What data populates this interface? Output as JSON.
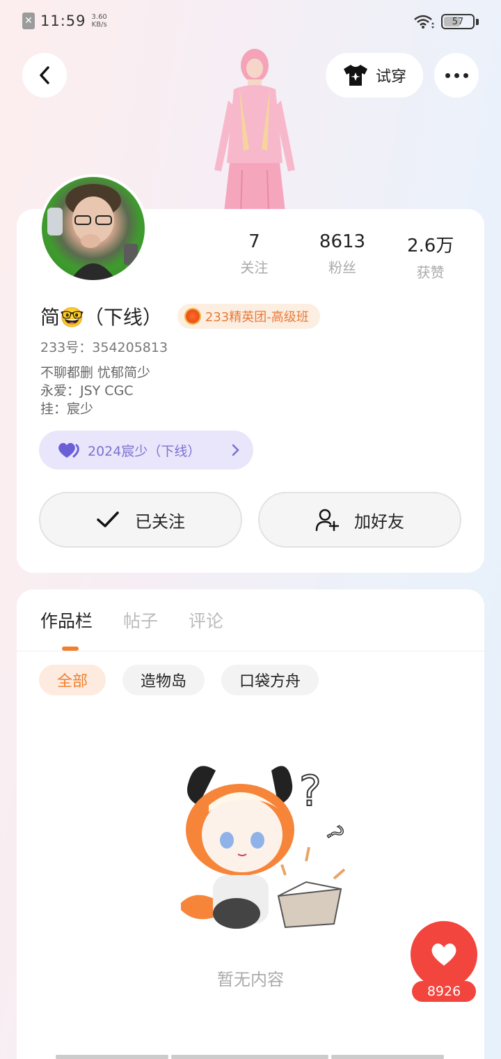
{
  "status_bar": {
    "time": "11:59",
    "net_speed_value": "3.60",
    "net_speed_unit": "KB/s",
    "battery": "57",
    "battery_level": 0.57
  },
  "header": {
    "try_on_label": "试穿"
  },
  "profile": {
    "stats": [
      {
        "value": "7",
        "label": "关注"
      },
      {
        "value": "8613",
        "label": "粉丝"
      },
      {
        "value": "2.6万",
        "label": "获赞"
      }
    ],
    "name": "简🤓（下线）",
    "badge": "233精英团-高级班",
    "uid_label": "233号：",
    "uid": "354205813",
    "bio": [
      "不聊都删 忧郁简少",
      "永爱：JSY CGC",
      "挂：宸少"
    ],
    "tag": "2024宸少（下线）",
    "follow_label": "已关注",
    "add_friend_label": "加好友"
  },
  "works": {
    "tabs": [
      "作品栏",
      "帖子",
      "评论"
    ],
    "filters": [
      "全部",
      "造物岛",
      "口袋方舟"
    ],
    "empty_text": "暂无内容"
  },
  "like": {
    "count": "8926"
  },
  "colors": {
    "accent": "#f07f2e",
    "like": "#f2453d",
    "tag_bg": "#e9e6fb",
    "tag_text": "#7a72cf"
  }
}
